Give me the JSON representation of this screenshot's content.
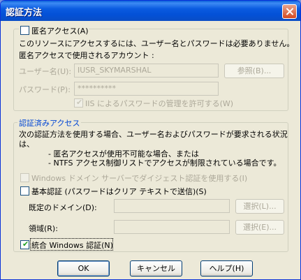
{
  "window": {
    "title": "認証方法"
  },
  "anonymous": {
    "checkbox_label": "匿名アクセス(A)",
    "checked": false,
    "description": "このリソースにアクセスするには、ユーザー名とパスワードは必要ありません。",
    "account_caption": "匿名アクセスで使用されるアカウント :",
    "username_label": "ユーザー名(U):",
    "username_value": "IUSR_SKYMARSHAL",
    "browse_label": "参照(B)...",
    "password_label": "パスワード(P):",
    "password_value": "**********",
    "iis_checkbox_label": "IIS によるパスワードの管理を許可する(W)",
    "iis_checked": true
  },
  "authenticated": {
    "group_title": "認証済みアクセス",
    "description_line1": "次の認証方法を使用する場合、ユーザー名およびパスワードが要求される状況",
    "description_line2": "は、",
    "bullet1": "- 匿名アクセスが使用不可能な場合、または",
    "bullet2": "- NTFS アクセス制御リストでアクセスが制限されている場合です。",
    "digest_label": "Windows ドメイン サーバーでダイジェスト認証を使用する(I)",
    "digest_checked": false,
    "basic_label": "基本認証 (パスワードはクリア テキストで送信)(S)",
    "basic_checked": false,
    "domain_label": "既定のドメイン(D):",
    "domain_value": "",
    "domain_select_label": "選択(L)...",
    "realm_label": "領域(R):",
    "realm_value": "",
    "realm_select_label": "選択(E)...",
    "integrated_label": "統合 Windows 認証(N)",
    "integrated_checked": true
  },
  "footer": {
    "ok_label": "OK",
    "cancel_label": "キャンセル",
    "help_label": "ヘルプ(H)"
  },
  "icons": {
    "check": "✔",
    "close": "close-icon"
  }
}
